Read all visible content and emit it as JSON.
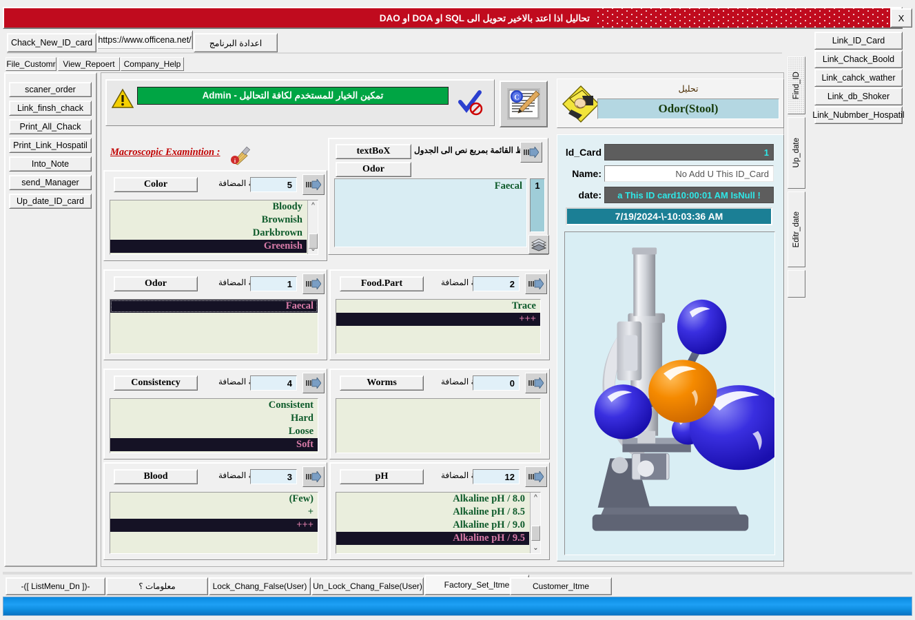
{
  "window": {
    "title_ar": "تحاليل اذا اعتد بالاخير تحويل الى SQL او DOA او DAO",
    "close_label": "X"
  },
  "top_tabs": [
    {
      "label": "Chack_New_ID_card",
      "selected": false
    },
    {
      "label": "https://www.officena.net/",
      "selected": true
    },
    {
      "label": "اعدادة البرنامج",
      "selected": false
    }
  ],
  "menu_tabs": [
    {
      "label": "File_Customr",
      "selected": true
    },
    {
      "label": "View_Repoert",
      "selected": false
    },
    {
      "label": "Company_Help",
      "selected": false
    }
  ],
  "left_buttons": [
    {
      "label": "scaner_order"
    },
    {
      "label": "Link_finsh_chack"
    },
    {
      "label": "Print_All_Chack"
    },
    {
      "label": "Print_Link_Hospatil"
    },
    {
      "label": "Into_Note"
    },
    {
      "label": "send_Manager"
    },
    {
      "label": "Up_date_ID_card"
    }
  ],
  "right_buttons": [
    {
      "label": "Link_ID_Card"
    },
    {
      "label": "Link_Chack_Boold"
    },
    {
      "label": "Link_cahck_wather"
    },
    {
      "label": "Link_db_Shoker"
    },
    {
      "label": "Link_Nubmber_Hospatil"
    }
  ],
  "banner": {
    "message": "تمكين الخيار للمستخدم لكافة التحاليل - Admin",
    "green_color": "#00a544"
  },
  "analysis": {
    "label_ar": "تحليل",
    "value": "Odor(Stool)"
  },
  "id_card": {
    "id_label": "ld_Card",
    "id_value": "1",
    "name_label": "Name:",
    "name_value": "No Add U This ID_Card",
    "date_label": "date:",
    "date_value": "a This ID card10:00:01 AM IsNull !",
    "timestamp": "7/19/2024-\\-10:03:36 AM"
  },
  "exam": {
    "heading": "Macroscopic Examintion :"
  },
  "textbox_panel": {
    "btn_textbox": "textBoX",
    "btn_odor": "Odor",
    "arabic_label": "حفظ القائمة بمربع نص الى الجدول",
    "count": "1",
    "items": [
      "Faecal"
    ]
  },
  "qty_label": "الكمية المضافة",
  "groups": [
    {
      "name": "Color",
      "qty": "5",
      "items": [
        "Bloody",
        "Brownish",
        "Darkbrown",
        "Greenish"
      ],
      "selected_index": 3,
      "scrollbar": true
    },
    {
      "name": "Odor",
      "qty": "1",
      "items": [
        "Faecal"
      ],
      "selected_index": 0,
      "scrollbar": false,
      "focus": true
    },
    {
      "name": "Food.Part",
      "qty": "2",
      "items": [
        "Trace",
        "+++"
      ],
      "selected_index": 1,
      "scrollbar": false
    },
    {
      "name": "Consistency",
      "qty": "4",
      "items": [
        "Consistent",
        "Hard",
        "Loose",
        "Soft"
      ],
      "selected_index": 3,
      "scrollbar": false
    },
    {
      "name": "Worms",
      "qty": "0",
      "items": [],
      "selected_index": -1,
      "scrollbar": false
    },
    {
      "name": "Blood",
      "qty": "3",
      "items": [
        "(Few)",
        "+",
        "+++"
      ],
      "selected_index": 2,
      "scrollbar": false
    },
    {
      "name": "pH",
      "qty": "12",
      "items": [
        "Alkaline pH / 8.0",
        "Alkaline pH / 8.5",
        "Alkaline pH / 9.0",
        "Alkaline pH / 9.5"
      ],
      "selected_index": 3,
      "scrollbar": true
    }
  ],
  "vertical_tabs": [
    {
      "label": "Find_ID",
      "selected": true
    },
    {
      "label": "Up_date",
      "selected": false
    },
    {
      "label": "Editr_date",
      "selected": false
    }
  ],
  "bottom_tabs": [
    {
      "label": "-([ ListMenu_Dn ])-",
      "selected": false
    },
    {
      "label": "معلومات ؟",
      "selected": false
    },
    {
      "label": "Lock_Chang_False(User)",
      "selected": false
    },
    {
      "label": "Un_Lock_Chang_False(User)",
      "selected": false
    },
    {
      "label": "Factory_Set_Itme",
      "selected": true
    },
    {
      "label": "Customer_Itme",
      "selected": false
    }
  ],
  "icons": {
    "warning": "warning-triangle-icon",
    "check": "check-disabled-icon",
    "document": "document-pencil-icon",
    "analysis": "hand-note-icon",
    "broom": "broom-icon",
    "save": "save-stack-icon",
    "arrow": "arrow-right-icon",
    "microscope": "microscope-molecule-image"
  }
}
